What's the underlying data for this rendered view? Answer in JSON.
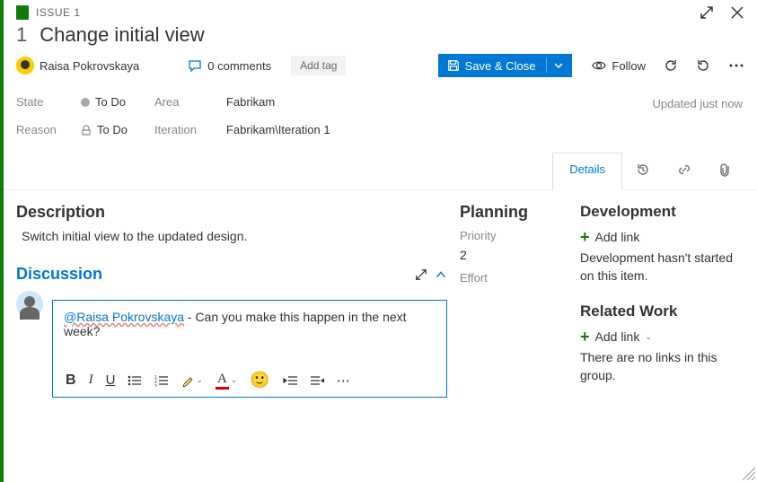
{
  "header": {
    "type": "ISSUE 1",
    "number": "1",
    "title": "Change initial view"
  },
  "assignee": "Raisa Pokrovskaya",
  "comments": "0 comments",
  "addTag": "Add tag",
  "saveClose": "Save & Close",
  "follow": "Follow",
  "fields": {
    "stateLabel": "State",
    "state": "To Do",
    "reasonLabel": "Reason",
    "reason": "To Do",
    "areaLabel": "Area",
    "area": "Fabrikam",
    "iterationLabel": "Iteration",
    "iteration": "Fabrikam\\Iteration 1"
  },
  "updated": "Updated just now",
  "tabs": {
    "details": "Details"
  },
  "description": {
    "heading": "Description",
    "text": "Switch initial view to the updated design."
  },
  "discussion": {
    "heading": "Discussion",
    "mention": "@Raisa Pokrovskaya",
    "rest": " - Can you make this happen in the next week?"
  },
  "planning": {
    "heading": "Planning",
    "priorityLabel": "Priority",
    "priority": "2",
    "effortLabel": "Effort"
  },
  "development": {
    "heading": "Development",
    "addLink": "Add link",
    "text": "Development hasn't started on this item."
  },
  "related": {
    "heading": "Related Work",
    "addLink": "Add link",
    "text": "There are no links in this group."
  }
}
